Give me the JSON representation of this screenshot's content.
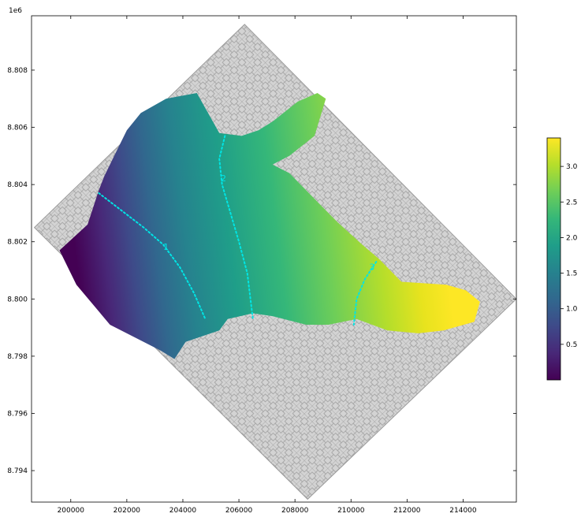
{
  "chart_data": {
    "type": "heatmap",
    "title": "",
    "xlabel": "",
    "ylabel": "",
    "y_offset_label": "1e6",
    "xlim": [
      198600,
      215900
    ],
    "ylim": [
      8.7929,
      8.8099
    ],
    "x_ticks": [
      200000,
      202000,
      204000,
      206000,
      208000,
      210000,
      212000,
      214000
    ],
    "x_tick_labels": [
      "200000",
      "202000",
      "204000",
      "206000",
      "208000",
      "210000",
      "212000",
      "214000"
    ],
    "y_ticks": [
      8.794,
      8.796,
      8.798,
      8.8,
      8.802,
      8.804,
      8.806,
      8.808
    ],
    "y_tick_labels": [
      "8.794",
      "8.796",
      "8.798",
      "8.800",
      "8.802",
      "8.804",
      "8.806",
      "8.808"
    ],
    "grid": false,
    "grid_domain_polygon": [
      [
        206200,
        8.8096
      ],
      [
        215900,
        8.8
      ],
      [
        208450,
        8.793
      ],
      [
        198700,
        8.8025
      ]
    ],
    "field_polygon": [
      [
        199600,
        8.8017
      ],
      [
        200600,
        8.8026
      ],
      [
        201000,
        8.8038
      ],
      [
        201200,
        8.8043
      ],
      [
        201600,
        8.8051
      ],
      [
        202000,
        8.8059
      ],
      [
        202500,
        8.8065
      ],
      [
        203400,
        8.807
      ],
      [
        204500,
        8.8072
      ],
      [
        205300,
        8.8058
      ],
      [
        206100,
        8.8057
      ],
      [
        206700,
        8.8059
      ],
      [
        207200,
        8.8062
      ],
      [
        208100,
        8.8069
      ],
      [
        208800,
        8.8072
      ],
      [
        209100,
        8.807
      ],
      [
        208700,
        8.8057
      ],
      [
        207800,
        8.805
      ],
      [
        207200,
        8.8047
      ],
      [
        207800,
        8.8044
      ],
      [
        208700,
        8.8035
      ],
      [
        209500,
        8.8027
      ],
      [
        210400,
        8.8019
      ],
      [
        211000,
        8.8014
      ],
      [
        211800,
        8.8006
      ],
      [
        213400,
        8.8005
      ],
      [
        214100,
        8.8003
      ],
      [
        214600,
        8.7999
      ],
      [
        214400,
        8.7992
      ],
      [
        213300,
        8.7989
      ],
      [
        212400,
        8.7988
      ],
      [
        211300,
        8.7989
      ],
      [
        210200,
        8.7993
      ],
      [
        209200,
        8.7991
      ],
      [
        208400,
        8.7991
      ],
      [
        207200,
        8.7994
      ],
      [
        206500,
        8.7995
      ],
      [
        205600,
        8.7993
      ],
      [
        205300,
        8.7989
      ],
      [
        204700,
        8.7987
      ],
      [
        204100,
        8.7985
      ],
      [
        203700,
        8.7979
      ],
      [
        203200,
        8.7982
      ],
      [
        201400,
        8.7991
      ],
      [
        200200,
        8.8005
      ]
    ],
    "colorbar": {
      "colormap": "viridis",
      "vmin": 0.0,
      "vmax": 3.4,
      "ticks": [
        0.5,
        1.0,
        1.5,
        2.0,
        2.5,
        3.0
      ],
      "tick_labels": [
        "0.5",
        "1.0",
        "1.5",
        "2.0",
        "2.5",
        "3.0"
      ]
    },
    "contours": [
      {
        "level": 1,
        "label": "1",
        "points": [
          [
            201000,
            8.8037
          ],
          [
            201800,
            8.8031
          ],
          [
            202600,
            8.8025
          ],
          [
            203300,
            8.8019
          ],
          [
            203900,
            8.8011
          ],
          [
            204400,
            8.8002
          ],
          [
            204800,
            8.7993
          ]
        ],
        "label_at": [
          203400,
          8.8018
        ]
      },
      {
        "level": 2,
        "label": "2",
        "points": [
          [
            205500,
            8.8057
          ],
          [
            205300,
            8.8049
          ],
          [
            205400,
            8.804
          ],
          [
            205700,
            8.803
          ],
          [
            206000,
            8.802
          ],
          [
            206300,
            8.8009
          ],
          [
            206500,
            8.7993
          ]
        ],
        "label_at": [
          205450,
          8.8042
        ]
      },
      {
        "level": 3,
        "label": "3",
        "points": [
          [
            210900,
            8.8013
          ],
          [
            210500,
            8.8007
          ],
          [
            210200,
            8.8
          ],
          [
            210100,
            8.7991
          ]
        ],
        "label_at": [
          210750,
          8.8011
        ]
      }
    ],
    "colors": {
      "mesh_fill": "#d3d3d3",
      "mesh_line": "#9b9b9b",
      "contour": "#00e5e5",
      "axes": "#000000"
    }
  }
}
